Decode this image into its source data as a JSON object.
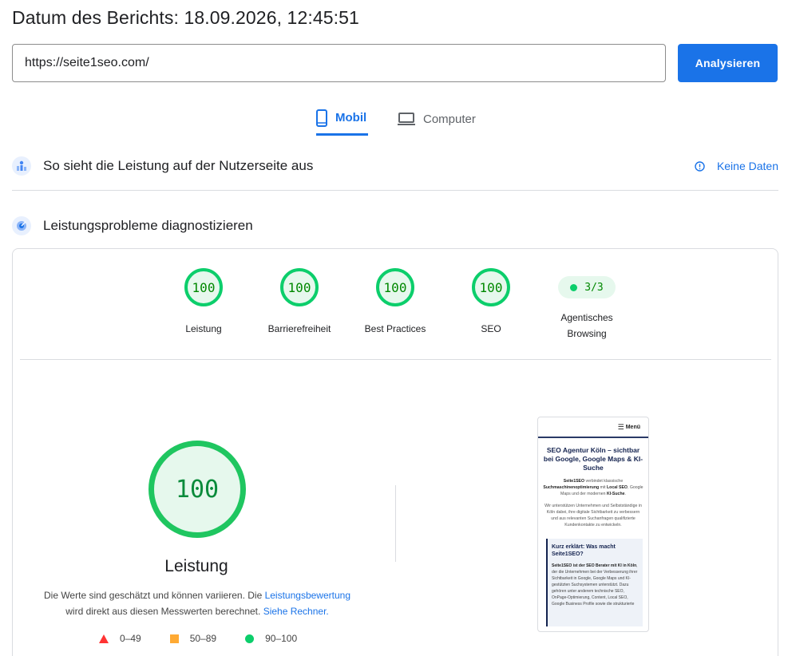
{
  "header": {
    "report_date": "Datum des Berichts: 18.09.2026, 12:45:51"
  },
  "url_bar": {
    "value": "https://seite1seo.com/",
    "analyze_label": "Analysieren"
  },
  "tabs": [
    {
      "label": "Mobil",
      "icon": "smartphone-icon",
      "active": true
    },
    {
      "label": "Computer",
      "icon": "laptop-icon",
      "active": false
    }
  ],
  "field_data": {
    "title": "So sieht die Leistung auf der Nutzerseite aus",
    "no_data_label": "Keine Daten"
  },
  "diagnostics": {
    "title": "Leistungsprobleme diagnostizieren",
    "categories": [
      {
        "score": "100",
        "label": "Leistung"
      },
      {
        "score": "100",
        "label": "Barrierefreiheit"
      },
      {
        "score": "100",
        "label": "Best Practices"
      },
      {
        "score": "100",
        "label": "SEO"
      }
    ],
    "agentic": {
      "value": "3/3",
      "label_line1": "Agentisches",
      "label_line2": "Browsing"
    },
    "main_score": "100",
    "main_label": "Leistung",
    "desc_part1": "Die Werte sind geschätzt und können variieren. Die ",
    "desc_link1": "Leistungsbewertung",
    "desc_part2": "wird direkt aus diesen Messwerten berechnet. ",
    "desc_link2": "Siehe Rechner.",
    "legend": [
      {
        "range": "0–49",
        "color": "#ff3333",
        "shape": "triangle"
      },
      {
        "range": "50–89",
        "color": "#ffaa33",
        "shape": "square"
      },
      {
        "range": "90–100",
        "color": "#0cce6b",
        "shape": "circle"
      }
    ]
  },
  "screenshot": {
    "menu_label": "Menü",
    "title": "SEO Agentur Köln – sichtbar bei Google, Google Maps & KI-Suche",
    "p1_b1": "Seite1SEO",
    "p1_t1": " verbindet klassische ",
    "p1_b2": "Suchmaschinenoptimierung",
    "p1_t2": " mit ",
    "p1_b3": "Local SEO",
    "p1_t3": ", Google Maps und der modernen ",
    "p1_b4": "KI-Suche",
    "p1_t4": ".",
    "p2": "Wir unterstützen Unternehmen und Selbstständige in Köln dabei, ihre digitale Sichtbarkeit zu verbessern und aus relevanten Suchanfragen qualifizierte Kundenkontakte zu entwickeln.",
    "box_title": "Kurz erklärt: Was macht Seite1SEO?",
    "box_b1": "Seite1SEO ist der SEO Berater mit KI in Köln",
    "box_t1": ", der die Unternehmen bei der Verbesserung ihrer Sichtbarkeit in Google, Google Maps und KI-gestützten Suchsystemen unterstützt. Dazu gehören unter anderem technische SEO, OnPage-Optimierung, Content, Local SEO, Google Business Profile sowie die strukturierte"
  },
  "colors": {
    "accent": "#1a73e8",
    "pass_green": "#0cce6b",
    "pass_text": "#008800"
  }
}
